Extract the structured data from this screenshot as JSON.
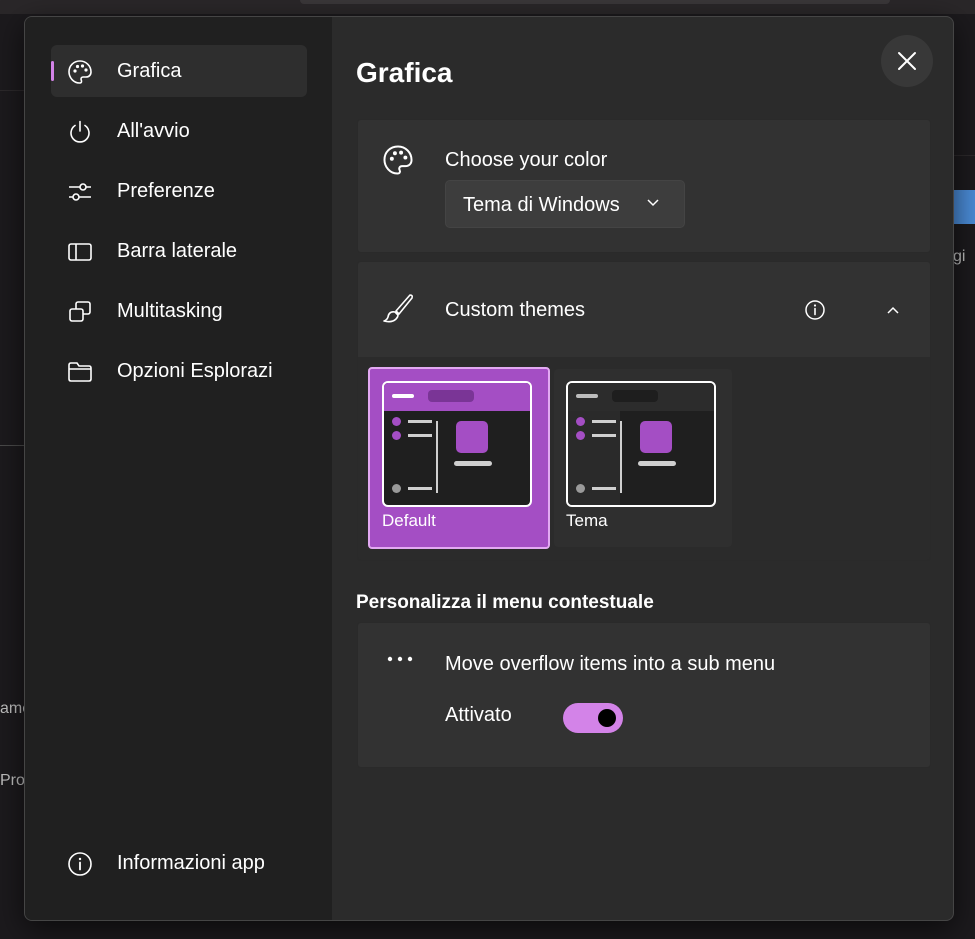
{
  "nav": {
    "items": [
      {
        "label": "Grafica",
        "icon": "palette-icon",
        "selected": true
      },
      {
        "label": "All'avvio",
        "icon": "power-icon"
      },
      {
        "label": "Preferenze",
        "icon": "sliders-icon"
      },
      {
        "label": "Barra laterale",
        "icon": "sidebar-icon"
      },
      {
        "label": "Multitasking",
        "icon": "multitasking-icon"
      },
      {
        "label": "Opzioni Esplorazi",
        "icon": "folder-icon"
      }
    ],
    "footer": {
      "label": "Informazioni app",
      "icon": "info-icon"
    }
  },
  "page": {
    "title": "Grafica"
  },
  "color_card": {
    "title": "Choose your color",
    "dropdown_value": "Tema di Windows"
  },
  "themes_card": {
    "title": "Custom themes",
    "tiles": [
      {
        "label": "Default",
        "selected": true
      },
      {
        "label": "Tema",
        "selected": false
      }
    ]
  },
  "context_menu": {
    "section_title": "Personalizza il menu contestuale",
    "option_title": "Move overflow items into a sub menu",
    "toggle_label": "Attivato",
    "toggle_on": true
  },
  "background": {
    "fragments": [
      "gi",
      "ame",
      "Pro"
    ]
  },
  "colors": {
    "accent": "#d383e8",
    "tile_accent": "#a44ec4",
    "dialog_bg": "#2b2b2b",
    "nav_bg": "#202020"
  }
}
